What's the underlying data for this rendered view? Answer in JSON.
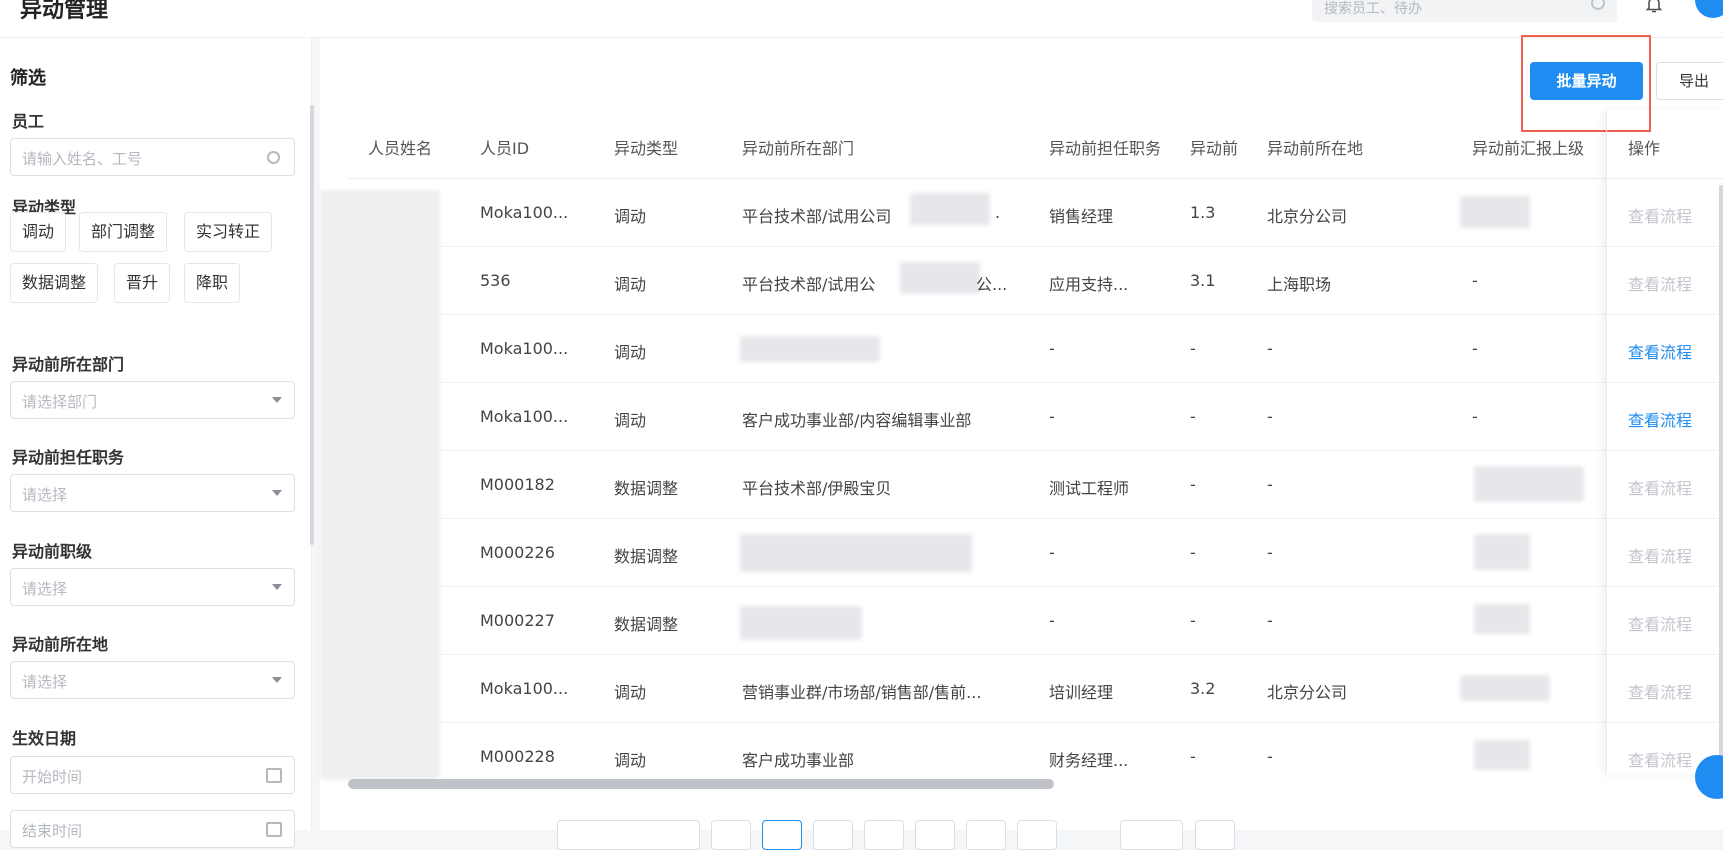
{
  "header": {
    "title": "异动管理",
    "search_placeholder": "搜索员工、待办"
  },
  "sidebar": {
    "title": "筛选",
    "employee": {
      "label": "员工",
      "placeholder": "请输入姓名、工号"
    },
    "change_type": {
      "label": "异动类型",
      "options": [
        "调动",
        "部门调整",
        "实习转正",
        "数据调整",
        "晋升",
        "降职"
      ]
    },
    "dept": {
      "label": "异动前所在部门",
      "placeholder": "请选择部门"
    },
    "position": {
      "label": "异动前担任职务",
      "placeholder": "请选择"
    },
    "level": {
      "label": "异动前职级",
      "placeholder": "请选择"
    },
    "location": {
      "label": "异动前所在地",
      "placeholder": "请选择"
    },
    "effective_date": {
      "label": "生效日期",
      "start_placeholder": "开始时间",
      "end_placeholder": "结束时间"
    }
  },
  "toolbar": {
    "batch_label": "批量异动",
    "export_label": "导出"
  },
  "table": {
    "columns": [
      "人员姓名",
      "人员ID",
      "异动类型",
      "异动前所在部门",
      "异动前担任职务",
      "异动前",
      "异动前所在地",
      "异动前汇报上级",
      "操作"
    ],
    "rows": [
      {
        "id": "Moka100...",
        "type": "调动",
        "dept": "平台技术部/试用公司",
        "dept_suffix": ".",
        "job": "销售经理",
        "level": "1.3",
        "loc": "北京分公司",
        "mgr": "",
        "action": "查看流程",
        "enabled": false
      },
      {
        "id": "536",
        "type": "调动",
        "dept": "平台技术部/试用公",
        "dept_suffix": "公...",
        "job": "应用支持...",
        "level": "3.1",
        "loc": "上海职场",
        "mgr": "-",
        "action": "查看流程",
        "enabled": false
      },
      {
        "id": "Moka100...",
        "type": "调动",
        "dept": "",
        "dept_suffix": "",
        "job": "-",
        "level": "-",
        "loc": "-",
        "mgr": "-",
        "action": "查看流程",
        "enabled": true
      },
      {
        "id": "Moka100...",
        "type": "调动",
        "dept": "客户成功事业部/内容编辑事业部",
        "dept_suffix": "",
        "job": "-",
        "level": "-",
        "loc": "-",
        "mgr": "-",
        "action": "查看流程",
        "enabled": true
      },
      {
        "id": "M000182",
        "type": "数据调整",
        "dept": "平台技术部/伊殿宝贝",
        "dept_suffix": "",
        "job": "测试工程师",
        "level": "-",
        "loc": "-",
        "mgr": "",
        "action": "查看流程",
        "enabled": false
      },
      {
        "id": "M000226",
        "type": "数据调整",
        "dept": "",
        "dept_suffix": "",
        "job": "-",
        "level": "-",
        "loc": "-",
        "mgr": "",
        "action": "查看流程",
        "enabled": false
      },
      {
        "id": "M000227",
        "type": "数据调整",
        "dept": "",
        "dept_suffix": "",
        "job": "-",
        "level": "-",
        "loc": "-",
        "mgr": "",
        "action": "查看流程",
        "enabled": false
      },
      {
        "id": "Moka100...",
        "type": "调动",
        "dept": "营销事业群/市场部/销售部/售前...",
        "dept_suffix": "",
        "job": "培训经理",
        "level": "3.2",
        "loc": "北京分公司",
        "mgr": "",
        "action": "查看流程",
        "enabled": false
      },
      {
        "id": "M000228",
        "type": "调动",
        "dept": "客户成功事业部",
        "dept_suffix": "",
        "job": "财务经理...",
        "level": "-",
        "loc": "-",
        "mgr": "",
        "action": "查看流程",
        "enabled": false
      }
    ]
  },
  "colors": {
    "primary": "#1e8cf0",
    "highlight": "#f0604d"
  }
}
